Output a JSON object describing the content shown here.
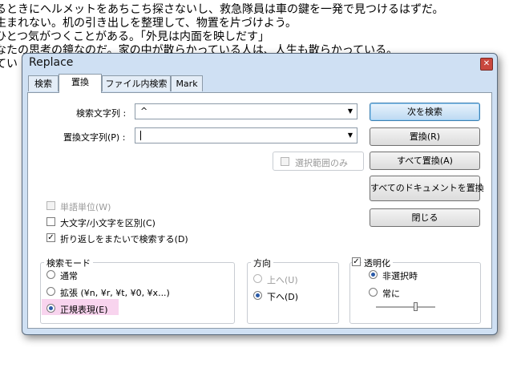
{
  "background_text": {
    "line1": "るときにヘルメットをあちこち探さないし、救急隊員は車の鍵を一発で見つけるはずだ。",
    "line2": "生まれない。机の引き出しを整理して、物置を片づけよう。",
    "line3": "ひとつ気がつくことがある。「外見は内面を映しだす」",
    "line4": "なたの思考の鏡なのだ。家の中が散らかっている人は、人生も散らかっている。",
    "line5": "てい"
  },
  "dialog": {
    "title": "Replace",
    "close_glyph": "✕",
    "tabs": [
      {
        "label": "検索"
      },
      {
        "label": "置換"
      },
      {
        "label": "ファイル内検索"
      },
      {
        "label": "Mark"
      }
    ],
    "active_tab": "置換"
  },
  "form": {
    "find_label": "検索文字列 :",
    "find_value": "^",
    "replace_label": "置換文字列(P) :",
    "replace_value": "",
    "in_selection_label": "選択範囲のみ",
    "dropdown_glyph": "▼"
  },
  "options": {
    "whole_word": {
      "label": "単語単位(W)",
      "checked": false,
      "enabled": false
    },
    "match_case": {
      "label": "大文字/小文字を区別(C)",
      "checked": false
    },
    "wrap_around": {
      "label": "折り返しをまたいで検索する(D)",
      "checked": true
    },
    "check_glyph": "✓"
  },
  "buttons": {
    "find_next": "次を検索",
    "replace": "置換(R)",
    "replace_all": "すべて置換(A)",
    "replace_all_docs": "すべてのドキュメントを置換",
    "close": "閉じる"
  },
  "search_mode": {
    "title": "検索モード",
    "options": [
      {
        "label": "通常",
        "selected": false
      },
      {
        "label": "拡張 (¥n, ¥r, ¥t, ¥0, ¥x...)",
        "selected": false
      },
      {
        "label": "正規表現(E)",
        "selected": true
      }
    ]
  },
  "direction": {
    "title": "方向",
    "options": [
      {
        "label": "上へ(U)",
        "selected": false,
        "enabled": false
      },
      {
        "label": "下へ(D)",
        "selected": true
      }
    ]
  },
  "transparency": {
    "title": "透明化",
    "checked": true,
    "options": [
      {
        "label": "非選択時",
        "selected": true
      },
      {
        "label": "常に",
        "selected": false
      }
    ]
  },
  "colors": {
    "dialog_bg": "#cfe0f3",
    "default_button": "#bcd9f2",
    "regex_highlight": "#f8d4ee",
    "close_button": "#c9473d"
  }
}
